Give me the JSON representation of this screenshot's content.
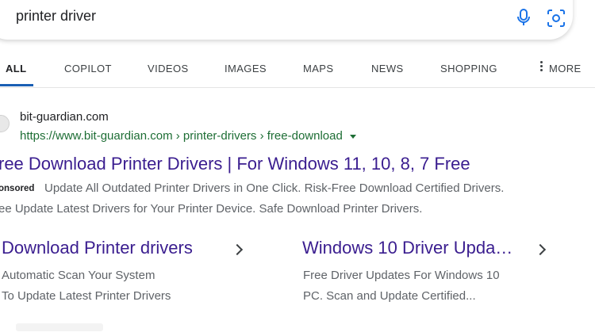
{
  "search": {
    "query": "printer driver"
  },
  "tabs": [
    {
      "label": "ALL"
    },
    {
      "label": "COPILOT"
    },
    {
      "label": "VIDEOS"
    },
    {
      "label": "IMAGES"
    },
    {
      "label": "MAPS"
    },
    {
      "label": "NEWS"
    },
    {
      "label": "SHOPPING"
    },
    {
      "label": "MORE"
    }
  ],
  "result": {
    "site_name": "bit-guardian.com",
    "url": "https://www.bit-guardian.com › printer-drivers › free-download",
    "title": "ree Download Printer Drivers | For Windows 11, 10, 8, 7 Free",
    "sponsored": "onsored",
    "description_line1": "Update All Outdated Printer Drivers in One Click. Risk-Free Download Certified Drivers.",
    "description_line2": "ee Update Latest Drivers for Your Printer Device. Safe Download Printer Drivers."
  },
  "sitelinks": [
    {
      "title": "Download Printer drivers",
      "desc_line1": "Automatic Scan Your System",
      "desc_line2": "To Update Latest Printer Drivers"
    },
    {
      "title": "Windows 10 Driver Upda…",
      "desc_line1": "Free Driver Updates For Windows 10",
      "desc_line2": "PC. Scan and Update Certified..."
    }
  ],
  "icons": {
    "mic": "microphone-icon",
    "lens": "visual-search-icon",
    "more": "vertical-dots-icon",
    "site": "site-favicon"
  },
  "colors": {
    "title_link": "#3a1d8f",
    "url_green": "#1e6e35",
    "active_tab_underline": "#1a5fb4"
  }
}
